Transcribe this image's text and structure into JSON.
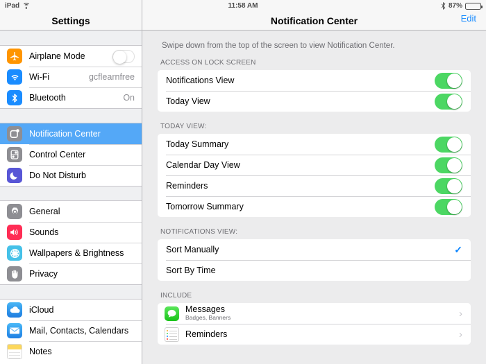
{
  "statusbar": {
    "device": "iPad",
    "wifi_icon": "wifi-icon",
    "time": "11:58 AM",
    "bluetooth_icon": "bluetooth-icon",
    "battery_percent": "87%",
    "battery_icon": "battery-icon"
  },
  "sidebar": {
    "title": "Settings",
    "groups": [
      {
        "items": [
          {
            "label": "Airplane Mode",
            "icon": "airplane-icon",
            "accessory": "toggle-off",
            "value": ""
          },
          {
            "label": "Wi-Fi",
            "icon": "wifi-icon",
            "accessory": "value",
            "value": "gcflearnfree"
          },
          {
            "label": "Bluetooth",
            "icon": "bluetooth-icon",
            "accessory": "value",
            "value": "On"
          }
        ]
      },
      {
        "items": [
          {
            "label": "Notification Center",
            "icon": "notification-center-icon",
            "accessory": "none",
            "value": "",
            "selected": true
          },
          {
            "label": "Control Center",
            "icon": "control-center-icon",
            "accessory": "none",
            "value": ""
          },
          {
            "label": "Do Not Disturb",
            "icon": "moon-icon",
            "accessory": "none",
            "value": ""
          }
        ]
      },
      {
        "items": [
          {
            "label": "General",
            "icon": "gear-icon",
            "accessory": "none",
            "value": ""
          },
          {
            "label": "Sounds",
            "icon": "speaker-icon",
            "accessory": "none",
            "value": ""
          },
          {
            "label": "Wallpapers & Brightness",
            "icon": "flower-icon",
            "accessory": "none",
            "value": ""
          },
          {
            "label": "Privacy",
            "icon": "hand-icon",
            "accessory": "none",
            "value": ""
          }
        ]
      },
      {
        "items": [
          {
            "label": "iCloud",
            "icon": "cloud-icon",
            "accessory": "none",
            "value": ""
          },
          {
            "label": "Mail, Contacts, Calendars",
            "icon": "envelope-icon",
            "accessory": "none",
            "value": ""
          },
          {
            "label": "Notes",
            "icon": "notes-icon",
            "accessory": "none",
            "value": ""
          }
        ]
      }
    ]
  },
  "main": {
    "title": "Notification Center",
    "edit_label": "Edit",
    "intro": "Swipe down from the top of the screen to view Notification Center.",
    "sections": [
      {
        "header": "ACCESS ON LOCK SCREEN",
        "rows": [
          {
            "label": "Notifications View",
            "toggle": "on"
          },
          {
            "label": "Today View",
            "toggle": "on"
          }
        ]
      },
      {
        "header": "TODAY VIEW:",
        "rows": [
          {
            "label": "Today Summary",
            "toggle": "on"
          },
          {
            "label": "Calendar Day View",
            "toggle": "on"
          },
          {
            "label": "Reminders",
            "toggle": "on"
          },
          {
            "label": "Tomorrow Summary",
            "toggle": "on"
          }
        ]
      },
      {
        "header": "NOTIFICATIONS VIEW:",
        "rows": [
          {
            "label": "Sort Manually",
            "checked": true,
            "check_glyph": "✓"
          },
          {
            "label": "Sort By Time",
            "checked": false
          }
        ]
      },
      {
        "header": "INCLUDE",
        "apps": [
          {
            "name": "Messages",
            "subtitle": "Badges, Banners",
            "icon": "messages-icon",
            "chevron": "›"
          },
          {
            "name": "Reminders",
            "subtitle": "",
            "icon": "reminders-icon",
            "chevron": "›"
          }
        ]
      }
    ]
  },
  "colors": {
    "accent_blue": "#1a8cff",
    "selection_blue": "#54a8f7",
    "toggle_green": "#4cd763",
    "panel_gray": "#ececed"
  }
}
